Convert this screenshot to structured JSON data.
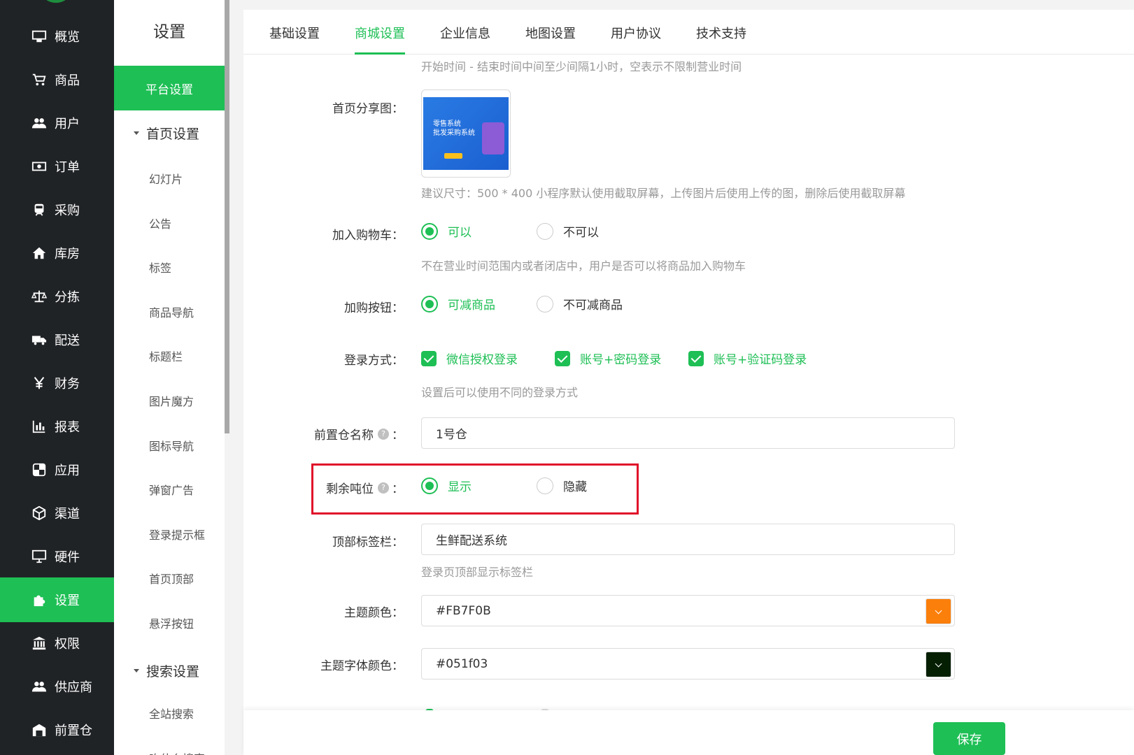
{
  "sidebar": {
    "items": [
      {
        "label": "概览",
        "icon": "monitor-icon",
        "active": false
      },
      {
        "label": "商品",
        "icon": "cart-icon",
        "active": false
      },
      {
        "label": "用户",
        "icon": "users-icon",
        "active": false
      },
      {
        "label": "订单",
        "icon": "money-icon",
        "active": false
      },
      {
        "label": "采购",
        "icon": "train-icon",
        "active": false
      },
      {
        "label": "库房",
        "icon": "home-icon",
        "active": false
      },
      {
        "label": "分拣",
        "icon": "balance-scale-icon",
        "active": false
      },
      {
        "label": "配送",
        "icon": "truck-icon",
        "active": false
      },
      {
        "label": "财务",
        "icon": "yen-icon",
        "active": false
      },
      {
        "label": "报表",
        "icon": "bar-chart-icon",
        "active": false
      },
      {
        "label": "应用",
        "icon": "apps-icon",
        "active": false
      },
      {
        "label": "渠道",
        "icon": "cube-icon",
        "active": false
      },
      {
        "label": "硬件",
        "icon": "desktop-icon",
        "active": false
      },
      {
        "label": "设置",
        "icon": "puzzle-icon",
        "active": true
      },
      {
        "label": "权限",
        "icon": "bank-icon",
        "active": false
      },
      {
        "label": "供应商",
        "icon": "users-icon",
        "active": false
      },
      {
        "label": "前置仓",
        "icon": "warehouse-icon",
        "active": false
      }
    ]
  },
  "subsidebar": {
    "title": "设置",
    "active_item": "平台设置",
    "group1": "首页设置",
    "group1_items": [
      "幻灯片",
      "公告",
      "标签",
      "商品导航",
      "标题栏",
      "图片魔方",
      "图标导航",
      "弹窗广告",
      "登录提示框",
      "首页顶部",
      "悬浮按钮"
    ],
    "group2": "搜索设置",
    "group2_items": [
      "全站搜索",
      "吃什么搜索"
    ]
  },
  "tabs": [
    {
      "label": "基础设置",
      "active": false
    },
    {
      "label": "商城设置",
      "active": true
    },
    {
      "label": "企业信息",
      "active": false
    },
    {
      "label": "地图设置",
      "active": false
    },
    {
      "label": "用户协议",
      "active": false
    },
    {
      "label": "技术支持",
      "active": false
    }
  ],
  "form": {
    "business_hours_hint": "开始时间 - 结束时间中间至少间隔1小时，空表示不限制营业时间",
    "share_image": {
      "label": "首页分享图：",
      "image_text_line1": "零售系统",
      "image_text_line2": "批发采购系统",
      "hint": "建议尺寸：500 * 400 小程序默认使用截取屏幕，上传图片后使用上传的图，删除后使用截取屏幕"
    },
    "add_to_cart": {
      "label": "加入购物车：",
      "options": [
        "可以",
        "不可以"
      ],
      "selected": "可以",
      "hint": "不在营业时间范围内或者闭店中，用户是否可以将商品加入购物车"
    },
    "purchase_button": {
      "label": "加购按钮：",
      "options": [
        "可减商品",
        "不可减商品"
      ],
      "selected": "可减商品"
    },
    "login_method": {
      "label": "登录方式：",
      "options": [
        "微信授权登录",
        "账号+密码登录",
        "账号+验证码登录"
      ],
      "checked": [
        true,
        true,
        true
      ],
      "hint": "设置后可以使用不同的登录方式"
    },
    "warehouse_name": {
      "label": "前置仓名称",
      "colon": "：",
      "value": "1号仓"
    },
    "remaining_tonnage": {
      "label": "剩余吨位",
      "colon": "：",
      "options": [
        "显示",
        "隐藏"
      ],
      "selected": "显示"
    },
    "top_tab_bar": {
      "label": "顶部标签栏：",
      "value": "生鲜配送系统",
      "hint": "登录页顶部显示标签栏"
    },
    "theme_color": {
      "label": "主题颜色：",
      "value": "#FB7F0B",
      "swatch": "#FB7F0B"
    },
    "theme_font_color": {
      "label": "主题字体颜色：",
      "value": "#051f03",
      "swatch": "#051f03"
    }
  },
  "help_glyph": "?",
  "footer": {
    "save_label": "保存"
  },
  "colors": {
    "accent": "#1ebf55",
    "sidebar_bg": "#202326",
    "highlight_box": "#e0102a"
  }
}
